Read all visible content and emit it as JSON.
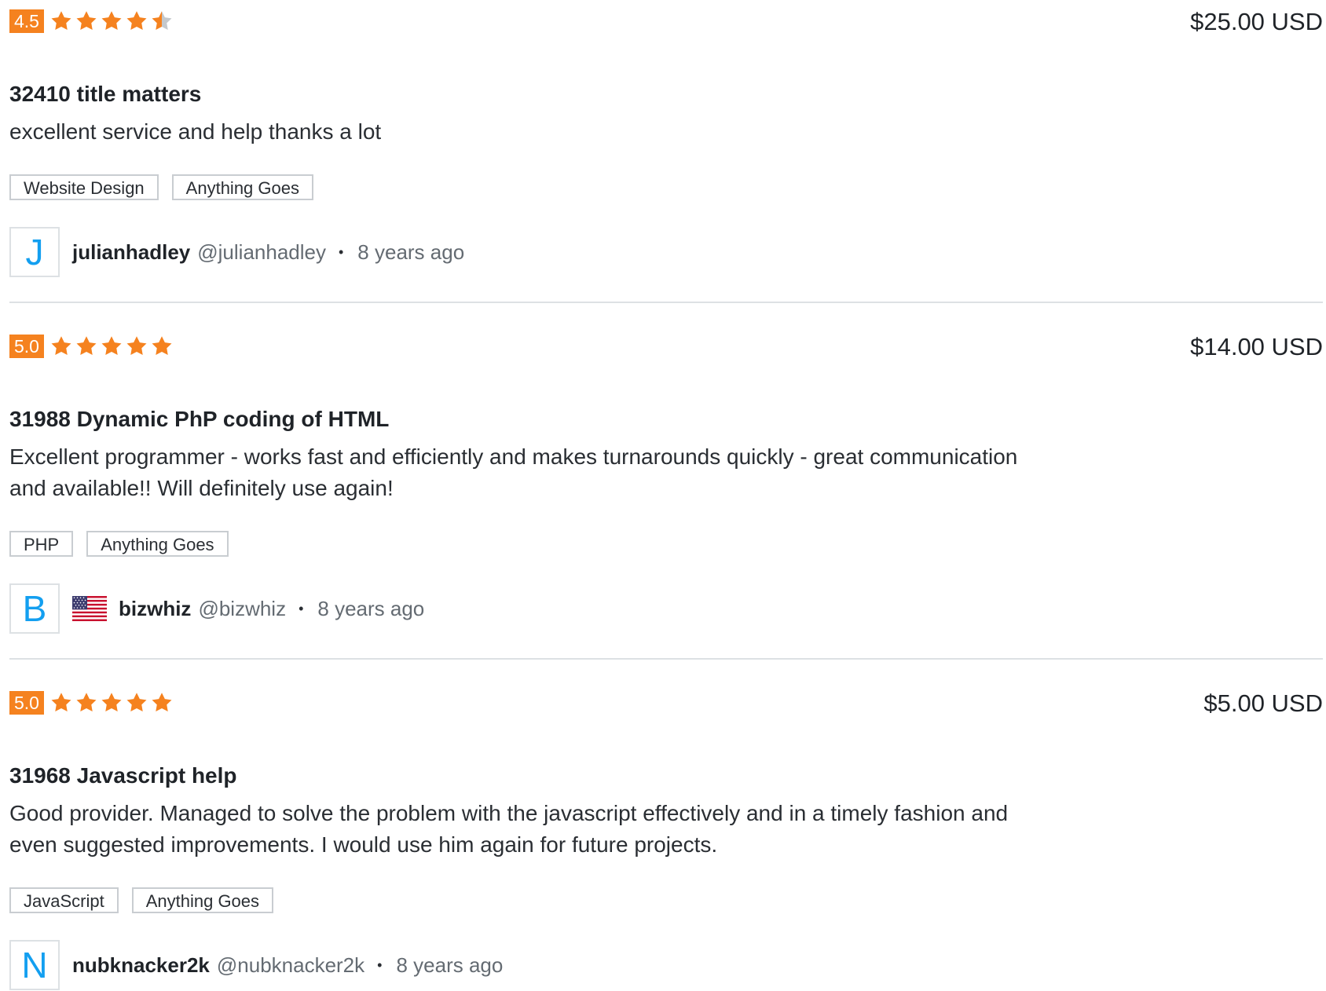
{
  "colors": {
    "accent": "#f5821f",
    "star_empty": "#c4c8cc",
    "avatar_letter": "#139ff0"
  },
  "reviews": [
    {
      "score": "4.5",
      "rating": 4.5,
      "price": "$25.00 USD",
      "title": "32410 title matters",
      "body": "excellent service and help thanks a lot",
      "tags": [
        "Website Design",
        "Anything Goes"
      ],
      "avatar_letter": "J",
      "flag": "",
      "username": "julianhadley",
      "handle": "@julianhadley",
      "separator": "•",
      "age": "8 years ago"
    },
    {
      "score": "5.0",
      "rating": 5,
      "price": "$14.00 USD",
      "title": "31988 Dynamic PhP coding of HTML",
      "body": "Excellent programmer - works fast and efficiently and makes turnarounds quickly - great communication and available!! Will definitely use again!",
      "tags": [
        "PHP",
        "Anything Goes"
      ],
      "avatar_letter": "B",
      "flag": "us-flag-icon",
      "username": "bizwhiz",
      "handle": "@bizwhiz",
      "separator": "•",
      "age": "8 years ago"
    },
    {
      "score": "5.0",
      "rating": 5,
      "price": "$5.00 USD",
      "title": "31968 Javascript help",
      "body": "Good provider. Managed to solve the problem with the javascript effectively and in a timely fashion and even suggested improvements. I would use him again for future projects.",
      "tags": [
        "JavaScript",
        "Anything Goes"
      ],
      "avatar_letter": "N",
      "flag": "",
      "username": "nubknacker2k",
      "handle": "@nubknacker2k",
      "separator": "•",
      "age": "8 years ago"
    }
  ]
}
